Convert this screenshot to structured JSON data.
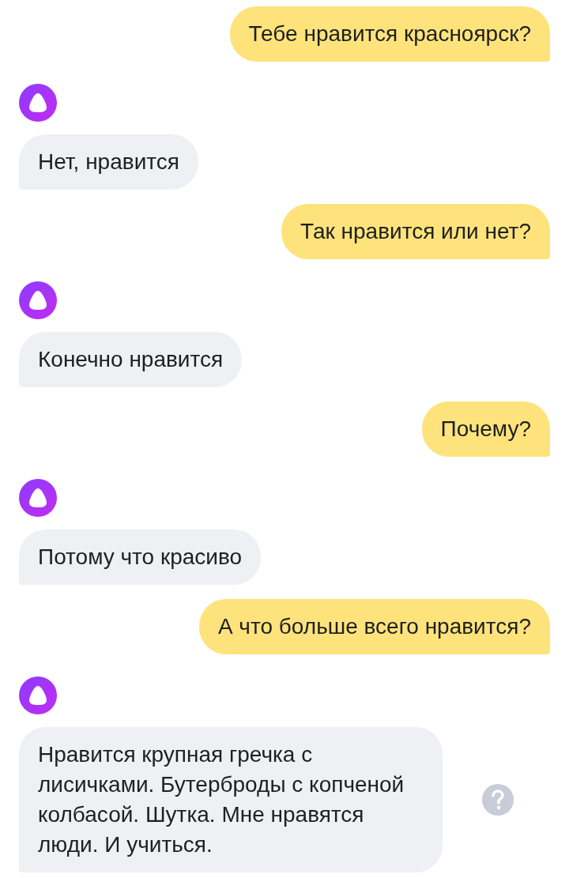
{
  "messages": [
    {
      "kind": "user",
      "text": "Тебе нравится красноярск?"
    },
    {
      "kind": "assistant",
      "text": "Нет, нравится"
    },
    {
      "kind": "user",
      "text": "Так нравится или нет?"
    },
    {
      "kind": "assistant",
      "text": "Конечно нравится"
    },
    {
      "kind": "user",
      "text": "Почему?"
    },
    {
      "kind": "assistant",
      "text": "Потому что красиво"
    },
    {
      "kind": "user",
      "text": "А что больше всего нравится?"
    },
    {
      "kind": "assistant",
      "text": "Нравится крупная гречка с лисичками. Бутерброды с копченой колбасой. Шутка. Мне нравятся люди. И учиться.",
      "help": true
    }
  ]
}
